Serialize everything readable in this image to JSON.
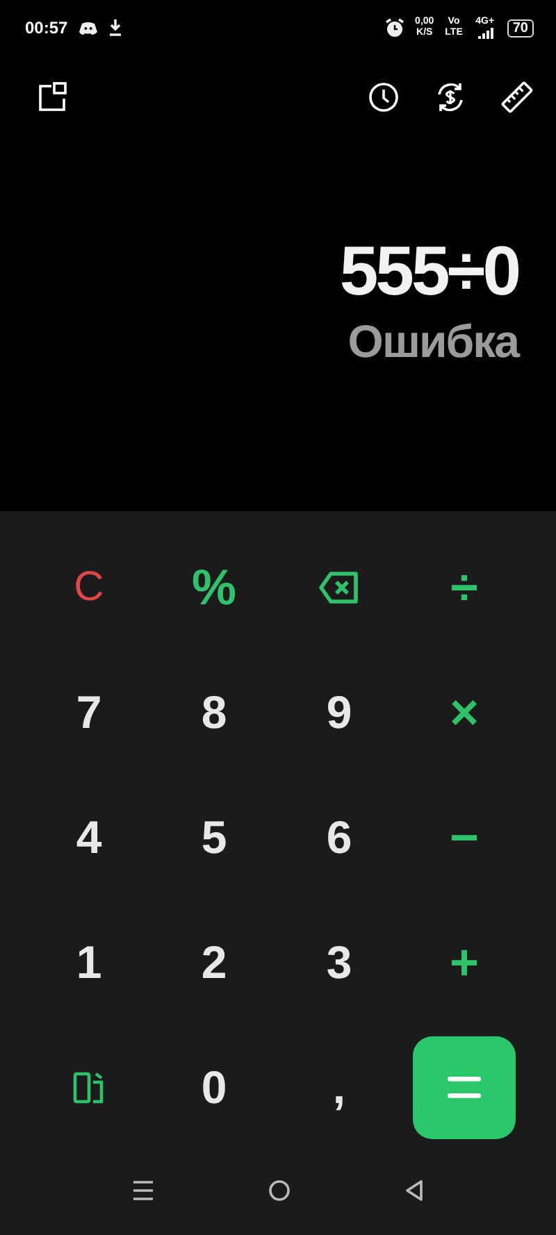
{
  "status_bar": {
    "time": "00:57",
    "speed_value": "0,00",
    "speed_unit": "K/S",
    "volte_top": "Vo",
    "volte_bottom": "LTE",
    "network": "4G+",
    "battery": "70"
  },
  "display": {
    "expression": "555÷0",
    "result": "Ошибка"
  },
  "keys": [
    {
      "kind": "clear",
      "label": "C"
    },
    {
      "kind": "operator",
      "label": "%"
    },
    {
      "kind": "backspace"
    },
    {
      "kind": "operator",
      "label": "÷"
    },
    {
      "kind": "digit",
      "label": "7"
    },
    {
      "kind": "digit",
      "label": "8"
    },
    {
      "kind": "digit",
      "label": "9"
    },
    {
      "kind": "operator",
      "label": "×"
    },
    {
      "kind": "digit",
      "label": "4"
    },
    {
      "kind": "digit",
      "label": "5"
    },
    {
      "kind": "digit",
      "label": "6"
    },
    {
      "kind": "operator",
      "label": "−"
    },
    {
      "kind": "digit",
      "label": "1"
    },
    {
      "kind": "digit",
      "label": "2"
    },
    {
      "kind": "digit",
      "label": "3"
    },
    {
      "kind": "operator",
      "label": "+"
    },
    {
      "kind": "rotate"
    },
    {
      "kind": "digit",
      "label": "0"
    },
    {
      "kind": "digit",
      "label": ","
    },
    {
      "kind": "equals"
    }
  ]
}
